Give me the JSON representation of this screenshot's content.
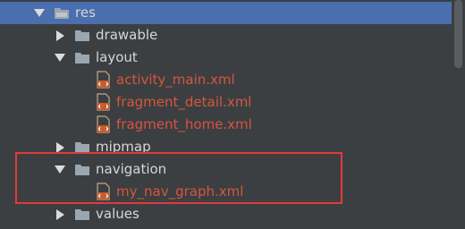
{
  "tree": {
    "items": [
      {
        "label": "res",
        "expanded": true,
        "kind": "folder",
        "selected": true
      },
      {
        "label": "drawable",
        "expanded": false,
        "kind": "folder"
      },
      {
        "label": "layout",
        "expanded": true,
        "kind": "folder"
      },
      {
        "label": "activity_main.xml",
        "kind": "xml-file"
      },
      {
        "label": "fragment_detail.xml",
        "kind": "xml-file"
      },
      {
        "label": "fragment_home.xml",
        "kind": "xml-file"
      },
      {
        "label": "mipmap",
        "expanded": false,
        "kind": "folder"
      },
      {
        "label": "navigation",
        "expanded": true,
        "kind": "folder"
      },
      {
        "label": "my_nav_graph.xml",
        "kind": "xml-file"
      },
      {
        "label": "values",
        "expanded": false,
        "kind": "folder"
      }
    ]
  },
  "colors": {
    "background": "#3c3f41",
    "selection": "#4b6eaf",
    "folder_text": "#d6d6d6",
    "file_text": "#d6553f",
    "highlight_border": "#e23a3a"
  }
}
